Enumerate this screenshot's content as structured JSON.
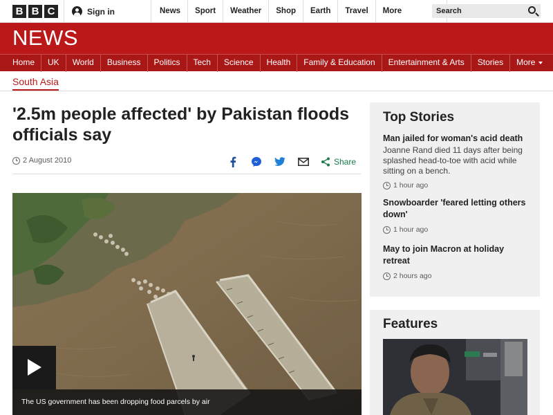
{
  "brand": {
    "letters": [
      "B",
      "B",
      "C"
    ],
    "news_title": "NEWS"
  },
  "account": {
    "signin_label": "Sign in"
  },
  "topnav": {
    "items": [
      "News",
      "Sport",
      "Weather",
      "Shop",
      "Earth",
      "Travel"
    ],
    "more_label": "More"
  },
  "search": {
    "placeholder": "Search"
  },
  "sectionnav": {
    "items": [
      "Home",
      "UK",
      "World",
      "Business",
      "Politics",
      "Tech",
      "Science",
      "Health",
      "Family & Education",
      "Entertainment & Arts",
      "Stories"
    ],
    "more_label": "More"
  },
  "article": {
    "section": "South Asia",
    "headline": "'2.5m people affected' by Pakistan floods officials say",
    "date": "2 August 2010",
    "share_label": "Share",
    "image_caption": "The US government has been dropping food parcels by air"
  },
  "top_stories": {
    "title": "Top Stories",
    "items": [
      {
        "title": "Man jailed for woman's acid death",
        "summary": "Joanne Rand died 11 days after being splashed head-to-toe with acid while sitting on a bench.",
        "time": "1 hour ago"
      },
      {
        "title": "Snowboarder 'feared letting others down'",
        "summary": "",
        "time": "1 hour ago"
      },
      {
        "title": "May to join Macron at holiday retreat",
        "summary": "",
        "time": "2 hours ago"
      }
    ]
  },
  "features": {
    "title": "Features"
  },
  "colors": {
    "brand_red": "#bb1919",
    "nav_red": "#a91717"
  }
}
